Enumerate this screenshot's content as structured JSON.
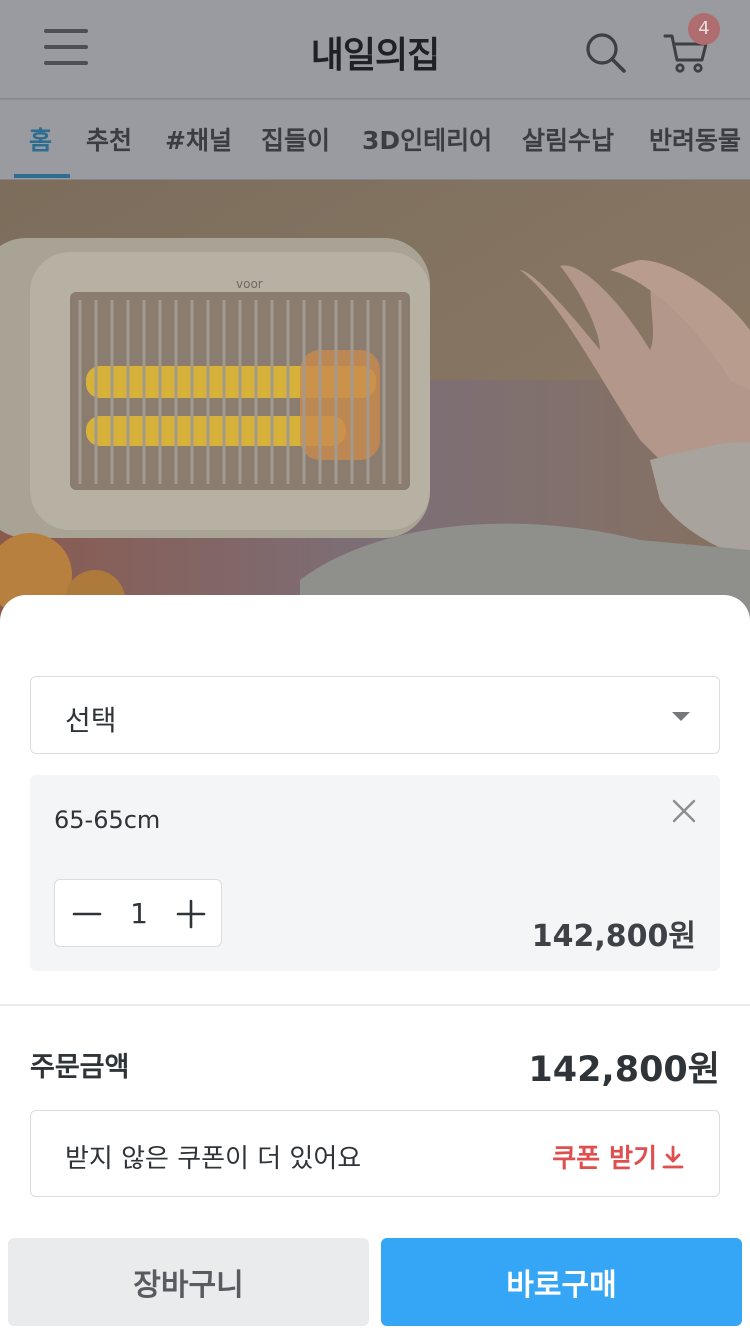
{
  "header": {
    "logo_text": "내일의집",
    "cart_count": "4"
  },
  "tabs": [
    {
      "label": "홈",
      "active": true
    },
    {
      "label": "추천"
    },
    {
      "label": "#채널"
    },
    {
      "label": "집들이"
    },
    {
      "label": "3D인테리어"
    },
    {
      "label": "살림수납"
    },
    {
      "label": "반려동물"
    }
  ],
  "hero": {
    "brand_text": "voor"
  },
  "sheet": {
    "select": {
      "value": "선택"
    },
    "option": {
      "name": "65-65cm",
      "quantity": "1",
      "price": "142,800원"
    },
    "total": {
      "label": "주문금액",
      "price": "142,800원"
    },
    "coupon": {
      "message": "받지 않은 쿠폰이 더 있어요",
      "action": "쿠폰 받기"
    },
    "buttons": {
      "cart": "장바구니",
      "buy": "바로구매"
    }
  },
  "colors": {
    "accent": "#35a5f5",
    "coupon": "#e04f4f",
    "active_tab": "#2f6d90"
  }
}
